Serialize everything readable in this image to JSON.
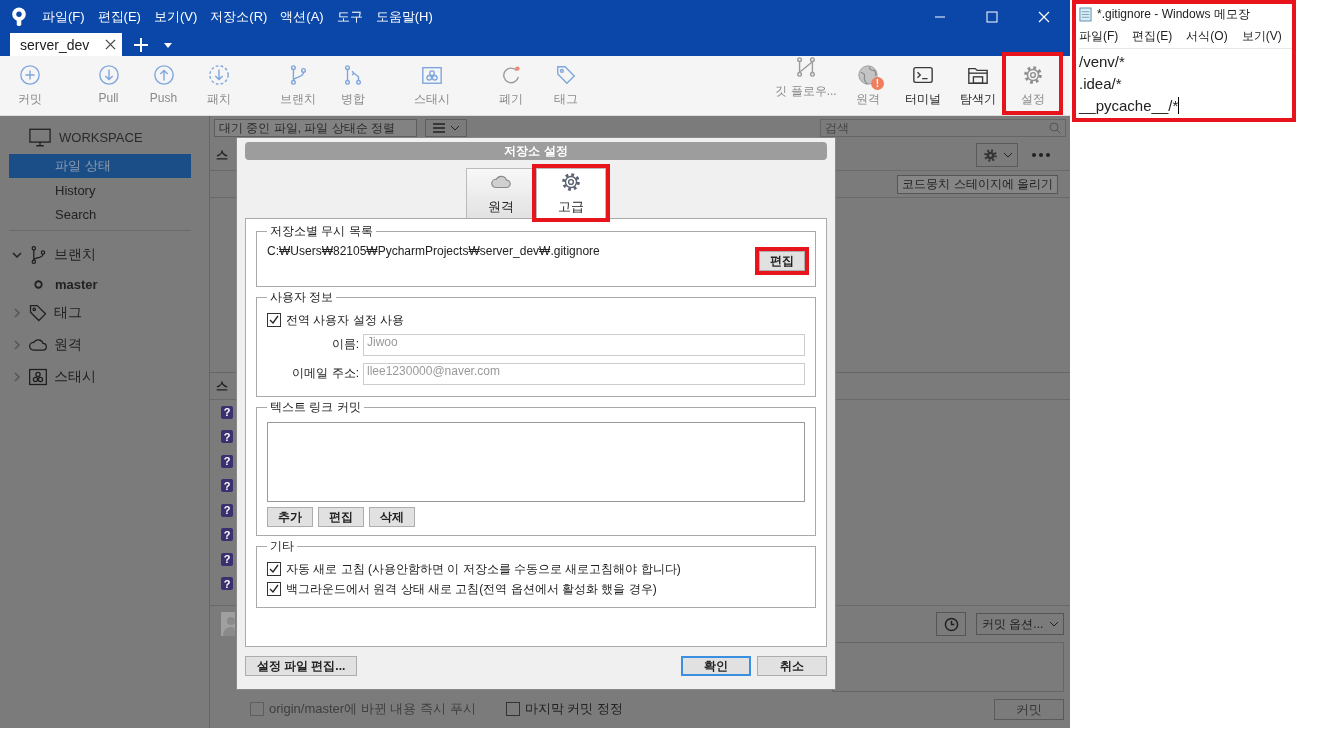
{
  "title_bar": {
    "menus": [
      "파일(F)",
      "편집(E)",
      "보기(V)",
      "저장소(R)",
      "액션(A)",
      "도구",
      "도움말(H)"
    ]
  },
  "tabs": [
    {
      "label": "server_dev",
      "selected": true
    }
  ],
  "toolbar": {
    "left_groups": [
      [
        {
          "kind": "commit",
          "label": "커밋",
          "disabled": true
        }
      ],
      [
        {
          "kind": "pull",
          "label": "Pull",
          "disabled": true
        },
        {
          "kind": "push",
          "label": "Push",
          "disabled": true
        },
        {
          "kind": "fetch",
          "label": "패치",
          "disabled": true
        }
      ],
      [
        {
          "kind": "branch",
          "label": "브랜치",
          "disabled": true
        },
        {
          "kind": "merge",
          "label": "병합",
          "disabled": true
        }
      ],
      [
        {
          "kind": "stash",
          "label": "스태시",
          "disabled": true
        }
      ],
      [
        {
          "kind": "discard",
          "label": "폐기",
          "disabled": true
        },
        {
          "kind": "tag",
          "label": "태그",
          "disabled": true
        }
      ]
    ],
    "right": [
      {
        "kind": "gitflow",
        "label": "깃 플로우...",
        "disabled": true
      },
      {
        "kind": "remote",
        "label": "원격",
        "disabled": true,
        "badge": "!"
      },
      {
        "kind": "terminal",
        "label": "터미널",
        "disabled": false
      },
      {
        "kind": "explorer",
        "label": "탐색기",
        "disabled": false
      },
      {
        "kind": "settings",
        "label": "설정",
        "disabled": true,
        "highlighted": true
      }
    ]
  },
  "sidebar": {
    "workspace": "WORKSPACE",
    "items": [
      {
        "label": "파일 상태",
        "selected": true
      },
      {
        "label": "History",
        "selected": false
      },
      {
        "label": "Search",
        "selected": false
      }
    ],
    "sections": [
      {
        "kind": "branches",
        "label": "브랜치",
        "expanded": true,
        "children": [
          {
            "label": "master"
          }
        ]
      },
      {
        "kind": "tags",
        "label": "태그",
        "expanded": false
      },
      {
        "kind": "remotes",
        "label": "원격",
        "expanded": false
      },
      {
        "kind": "stashes",
        "label": "스태시",
        "expanded": false
      }
    ]
  },
  "main": {
    "sort_dropdown": "대기 중인 파일, 파일 상태순 정렬",
    "search_placeholder": "검색",
    "staged_header": "스",
    "stage_all_button": "코드뭉치 스테이지에 올리기",
    "unstaged_header": "스",
    "files": [
      {
        "status": "?"
      },
      {
        "status": "?"
      },
      {
        "status": "?"
      },
      {
        "status": "?"
      },
      {
        "status": "?"
      },
      {
        "status": "?"
      },
      {
        "status": "?"
      },
      {
        "status": "?"
      }
    ],
    "commit_options": "커밋 옵션...",
    "push_option": {
      "label": "origin/master에 바뀐 내용 즉시 푸시",
      "checked": false,
      "disabled": true
    },
    "amend_option": {
      "label": "마지막 커밋 정정",
      "checked": false,
      "disabled": false
    },
    "commit_button": {
      "label": "커밋",
      "disabled": true
    }
  },
  "dialog": {
    "title": "저장소 설정",
    "tabs": [
      {
        "kind": "remote",
        "label": "원격",
        "selected": false
      },
      {
        "kind": "advanced",
        "label": "고급",
        "selected": true,
        "highlighted": true
      }
    ],
    "ignore_group": {
      "title": "저장소별 무시 목록",
      "path": "C:₩Users₩82105₩PycharmProjects₩server_dev₩.gitignore",
      "edit_button": "편집",
      "highlighted": true
    },
    "user_group": {
      "title": "사용자 정보",
      "use_global": {
        "label": "전역 사용자 설정 사용",
        "checked": true
      },
      "fields": [
        {
          "label": "이름:",
          "value": "Jiwoo"
        },
        {
          "label": "이메일 주소:",
          "value": "llee1230000@naver.com"
        }
      ]
    },
    "links_group": {
      "title": "텍스트 링크 커밋",
      "buttons": [
        "추가",
        "편집",
        "삭제"
      ]
    },
    "misc_group": {
      "title": "기타",
      "options": [
        {
          "label": "자동 새로 고침 (사용안함하면 이 저장소를 수동으로 새로고침해야 합니다)",
          "checked": true
        },
        {
          "label": "백그라운드에서 원격 상태 새로 고침(전역 옵션에서 활성화 했을 경우)",
          "checked": true
        }
      ]
    },
    "edit_config_button": "설정 파일 편집...",
    "ok_button": "확인",
    "cancel_button": "취소"
  },
  "notepad": {
    "title": "*.gitignore - Windows 메모장",
    "menus": [
      "파일(F)",
      "편집(E)",
      "서식(O)",
      "보기(V)"
    ],
    "lines": [
      "/venv/*",
      ".idea/*",
      "__pycache__/*"
    ],
    "highlighted": true
  }
}
